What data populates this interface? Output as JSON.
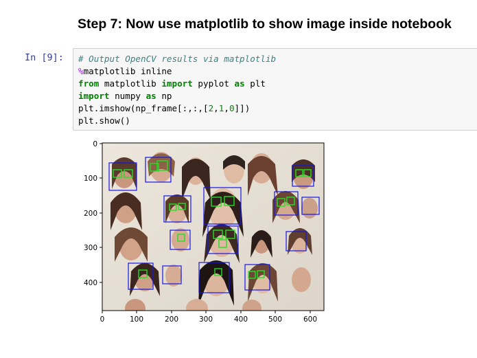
{
  "heading": "Step 7: Now use matplotlib to show image inside notebook",
  "cell": {
    "prompt": "In [9]:",
    "code": {
      "comment": "# Output OpenCV results via matplotlib",
      "magic_symbol": "%",
      "magic_rest": "matplotlib inline",
      "from_kw": "from",
      "from_mod": " matplotlib ",
      "import_kw": "import",
      "import_rest": " pyplot ",
      "as_kw": "as",
      "as_rest": " plt",
      "import2_kw": "import",
      "import2_mid": " numpy ",
      "as2_kw": "as",
      "as2_rest": " np",
      "imshow_a": "plt.imshow(np_frame[:,:,[",
      "num2": "2",
      "comma1": ",",
      "num1": "1",
      "comma2": ",",
      "num0": "0",
      "imshow_b": "]])",
      "show_line": "plt.show()"
    }
  },
  "plot": {
    "x_ticks": [
      "0",
      "100",
      "200",
      "300",
      "400",
      "500",
      "600"
    ],
    "y_ticks": [
      "0",
      "100",
      "200",
      "300",
      "400"
    ],
    "xlim": [
      0,
      640
    ],
    "ylim": [
      480,
      0
    ],
    "face_box_color": "#1515e6",
    "eye_box_color": "#22e022",
    "photo_description_colors": {
      "paper": "#e9e3d9",
      "skin": "#d2a48c",
      "hair": "#4a3026"
    }
  }
}
